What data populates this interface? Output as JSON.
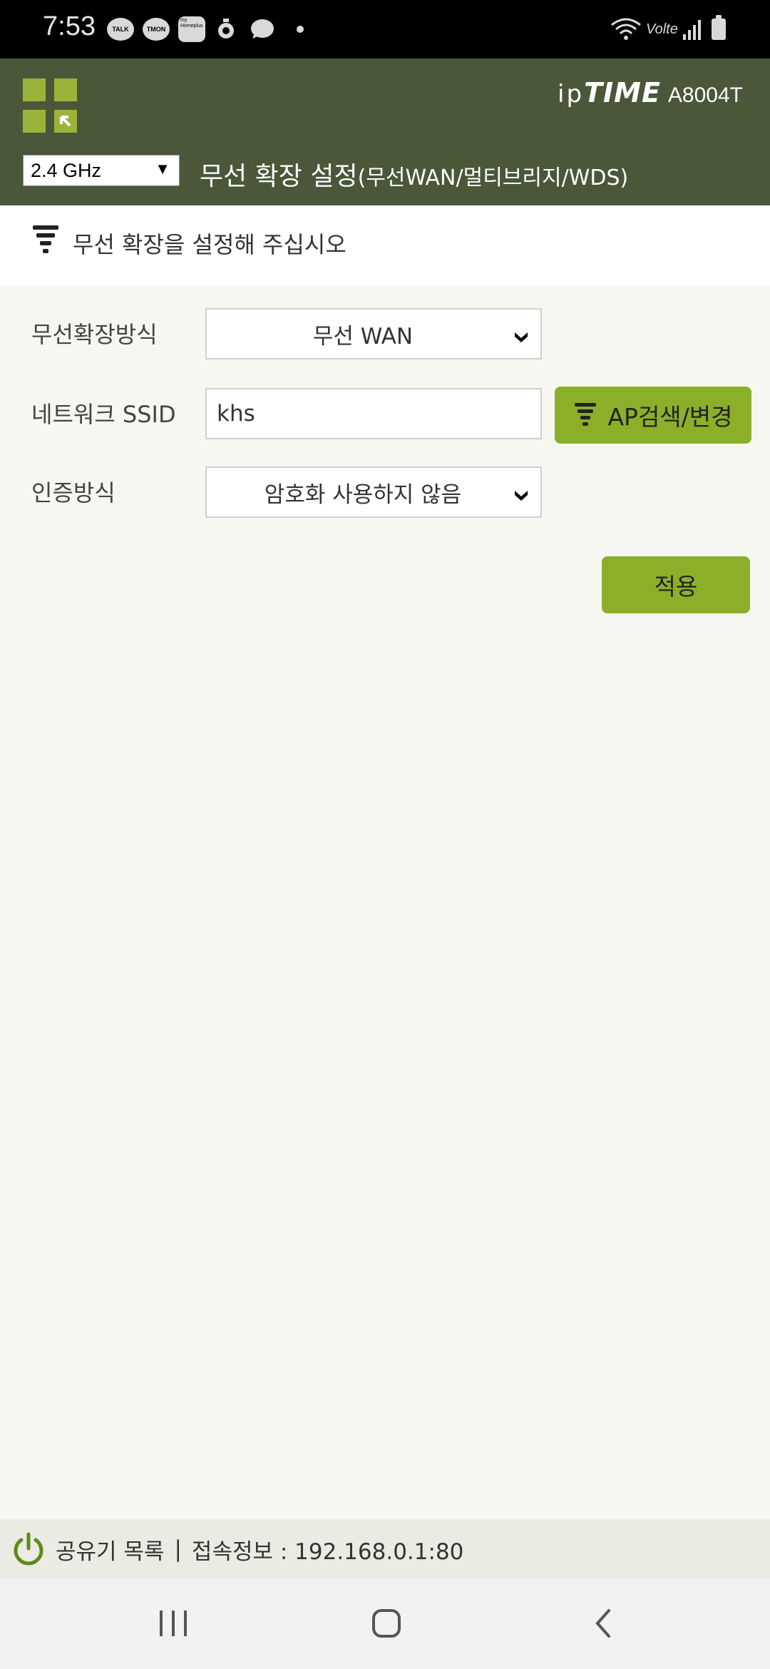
{
  "status_bar": {
    "time": "7:53",
    "notification_icons": [
      "TALK",
      "TMON",
      "my Homeplus"
    ],
    "network": "Volte"
  },
  "header": {
    "brand_ip": "ip",
    "brand_time": "TIME",
    "model": "A8004T",
    "band_select": "2.4 GHz",
    "title": "무선 확장 설정",
    "title_sub": "(무선WAN/멀티브리지/WDS)"
  },
  "instruction": {
    "text": "무선 확장을 설정해 주십시오"
  },
  "form": {
    "mode_label": "무선확장방식",
    "mode_value": "무선 WAN",
    "ssid_label": "네트워크 SSID",
    "ssid_value": "khs",
    "ap_button": "AP검색/변경",
    "auth_label": "인증방식",
    "auth_value": "암호화 사용하지 않음",
    "apply_button": "적용"
  },
  "footer": {
    "router_list": "공유기 목록",
    "separator": "|",
    "connection_info": "접속정보 : 192.168.0.1:80"
  },
  "colors": {
    "header_bg": "#4a5739",
    "accent_green": "#8caf2a",
    "logo_green": "#9ab43a",
    "page_bg": "#f7f7f2"
  }
}
